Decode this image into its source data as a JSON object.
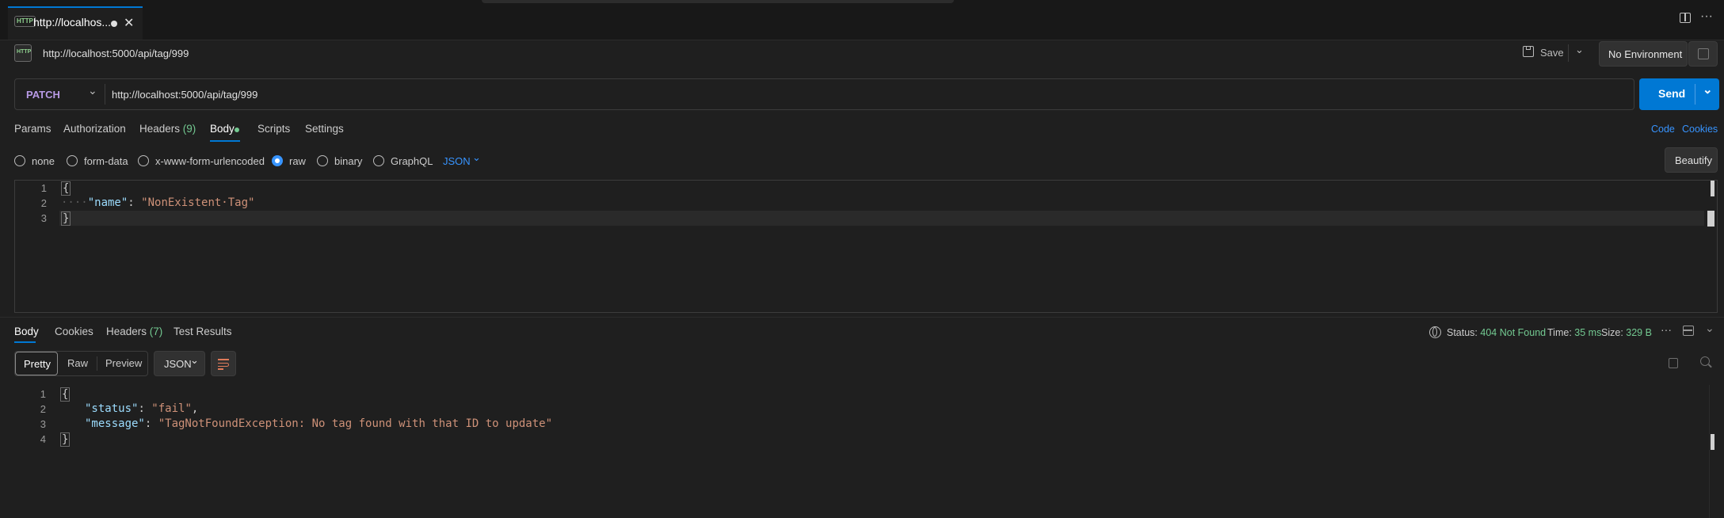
{
  "tab": {
    "title": "http://localhos...",
    "close": "✕"
  },
  "window": {
    "split_icon": "split-editor-icon",
    "more": "···"
  },
  "request": {
    "title": "http://localhost:5000/api/tag/999",
    "save_label": "Save",
    "environment": "No Environment",
    "method": "PATCH",
    "url": "http://localhost:5000/api/tag/999",
    "send_label": "Send"
  },
  "req_tabs": {
    "params": "Params",
    "authorization": "Authorization",
    "headers": "Headers",
    "headers_count": "(9)",
    "body": "Body",
    "scripts": "Scripts",
    "settings": "Settings",
    "code": "Code",
    "cookies": "Cookies"
  },
  "body_types": {
    "none": "none",
    "form_data": "form-data",
    "urlencoded": "x-www-form-urlencoded",
    "raw": "raw",
    "binary": "binary",
    "graphql": "GraphQL",
    "format": "JSON",
    "beautify": "Beautify"
  },
  "request_body": {
    "line_numbers": [
      "1",
      "2",
      "3"
    ],
    "open": "{",
    "indent": "····",
    "key": "\"name\"",
    "colon": ": ",
    "value": "\"NonExistent·Tag\"",
    "close": "}"
  },
  "resp_tabs": {
    "body": "Body",
    "cookies": "Cookies",
    "headers": "Headers",
    "headers_count": "(7)",
    "test_results": "Test Results"
  },
  "status": {
    "status_label": "Status:",
    "status_value": "404 Not Found",
    "time_label": "Time:",
    "time_value": "35 ms",
    "size_label": "Size:",
    "size_value": "329 B",
    "more": "···"
  },
  "resp_view": {
    "pretty": "Pretty",
    "raw": "Raw",
    "preview": "Preview",
    "format": "JSON"
  },
  "response_body": {
    "line_numbers": [
      "1",
      "2",
      "3",
      "4"
    ],
    "open": "{",
    "k1": "\"status\"",
    "v1": "\"fail\"",
    "k2": "\"message\"",
    "v2": "\"TagNotFoundException: No tag found with that ID to update\"",
    "colon": ": ",
    "comma": ",",
    "close": "}"
  },
  "colors": {
    "accent": "#0078d4",
    "success_green": "#73c991",
    "link_blue": "#3794ff",
    "json_key": "#9cdcfe",
    "json_string": "#ce9178"
  }
}
